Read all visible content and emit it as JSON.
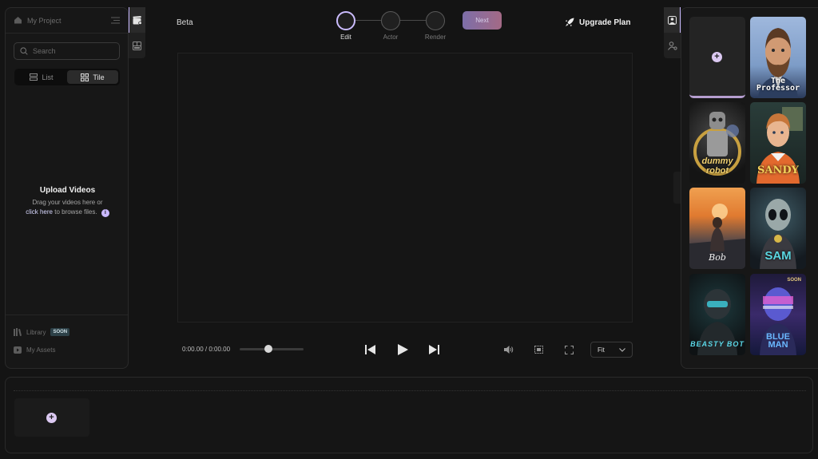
{
  "left_panel": {
    "project_label": "My Project",
    "search_placeholder": "Search",
    "view_list": "List",
    "view_tile": "Tile",
    "upload_title": "Upload Videos",
    "upload_line1": "Drag your videos here or",
    "upload_link": "click here",
    "upload_line2": "to browse files.",
    "info_glyph": "i",
    "library": "Library",
    "library_badge": "SOON",
    "assets": "My Assets"
  },
  "header": {
    "beta": "Beta",
    "steps": [
      {
        "label": "Edit"
      },
      {
        "label": "Actor"
      },
      {
        "label": "Render"
      }
    ],
    "next": "Next",
    "upgrade": "Upgrade Plan"
  },
  "player": {
    "time": "0:00.00 / 0:00.00",
    "progress": 0.45,
    "fit_value": "Fit"
  },
  "actors": {
    "add_glyph": "+",
    "cards": [
      {
        "name": "The Professor"
      },
      {
        "name": "dummy robot"
      },
      {
        "name": "SANDY"
      },
      {
        "name": "Bob"
      },
      {
        "name": "SAM"
      },
      {
        "name": "BEASTY BOT"
      },
      {
        "name": "BLUE MAN",
        "tag": "SOON"
      }
    ]
  },
  "timeline": {
    "add_glyph": "+"
  },
  "colors": {
    "accent": "#c7b8ff",
    "background": "#141414",
    "panel": "#171717"
  }
}
